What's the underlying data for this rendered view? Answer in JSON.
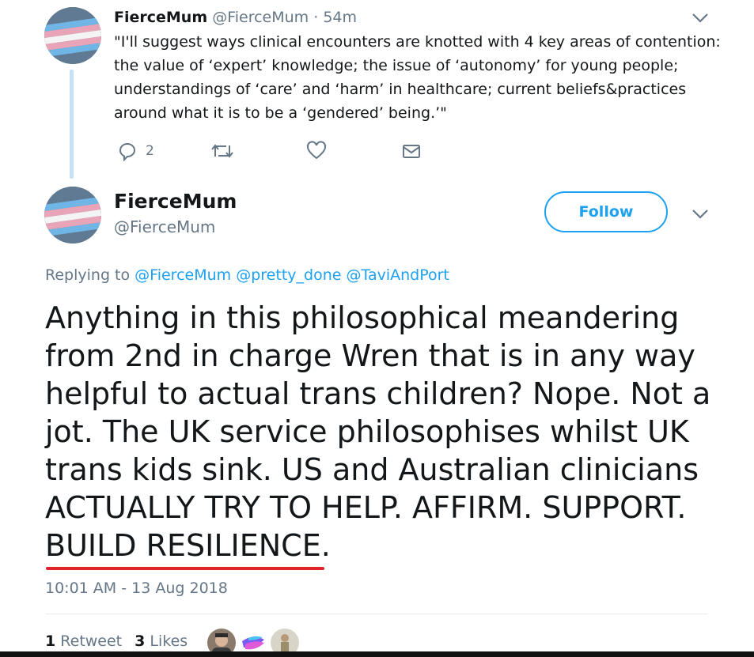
{
  "previous_tweet": {
    "display_name": "FierceMum",
    "handle": "@FierceMum",
    "separator": "·",
    "time_ago": "54m",
    "text_lines": [
      "\"I'll suggest ways clinical encounters are knotted with 4 key areas of contention:",
      "the value of ‘expert’ knowledge; the issue of ‘autonomy’ for young people;",
      "understandings of ‘care’ and ‘harm’ in healthcare; current beliefs&practices",
      "around what it is to be a ‘gendered’ being.’\""
    ],
    "actions": {
      "reply_icon": "reply-icon",
      "reply_count": "2",
      "retweet_icon": "retweet-icon",
      "like_icon": "heart-icon",
      "message_icon": "envelope-icon"
    }
  },
  "main_tweet": {
    "display_name": "FierceMum",
    "handle": "@FierceMum",
    "follow_label": "Follow",
    "replying_to_label": "Replying to",
    "replying_to": [
      "@FierceMum",
      "@pretty_done",
      "@TaviAndPort"
    ],
    "text_lines": [
      "Anything in this philosophical meandering",
      "from 2nd in charge Wren that is in any way",
      "helpful to actual trans children? Nope. Not a",
      "jot. The UK service philosophises whilst UK",
      "trans kids sink. US and Australian clinicians",
      "ACTUALLY TRY TO HELP. AFFIRM. SUPPORT.",
      "BUILD RESILIENCE."
    ],
    "timestamp": "10:01 AM - 13 Aug 2018",
    "retweet_count": "1",
    "retweet_label": "Retweet",
    "like_count": "3",
    "like_label": "Likes"
  },
  "colors": {
    "accent": "#1da1f2",
    "muted": "#657786",
    "text": "#14171a",
    "highlight_underline": "#e0242a",
    "thread_line": "#c4e4f5"
  }
}
